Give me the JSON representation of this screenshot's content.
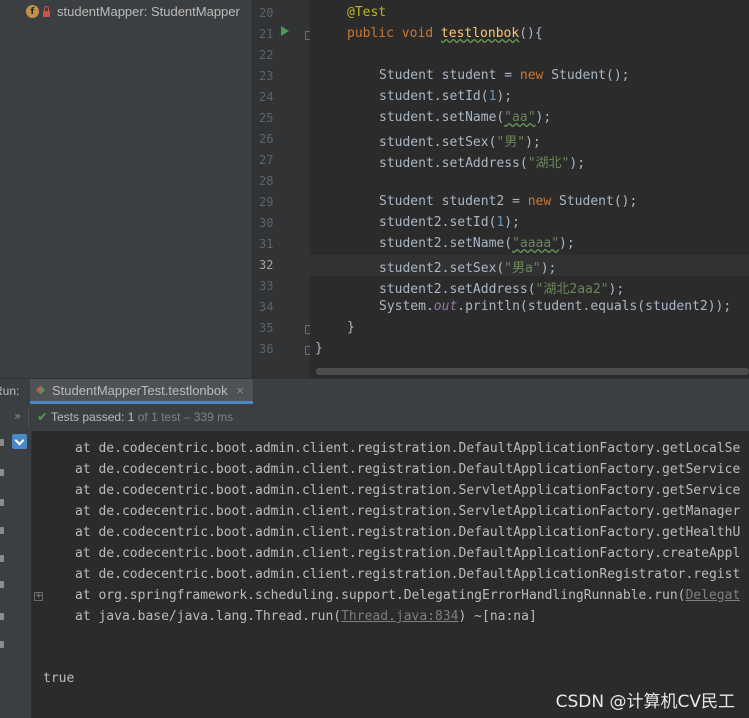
{
  "structure": {
    "item_label": "studentMapper: StudentMapper"
  },
  "gutter": {
    "line_numbers": [
      "20",
      "21",
      "22",
      "23",
      "24",
      "25",
      "26",
      "27",
      "28",
      "29",
      "30",
      "31",
      "32",
      "33",
      "34",
      "35",
      "36"
    ]
  },
  "editor": {
    "annotation": "@Test",
    "method_keywords": "public void ",
    "method_name": "testlonbok",
    "method_tail": "(){",
    "l23_type": "Student student = ",
    "l23_new": "new",
    "l23_tail": " Student();",
    "l24_call": "student.setId(",
    "l24_arg": "1",
    "l24_end": ");",
    "l25_call": "student.setName(",
    "l25_arg": "\"aa\"",
    "l25_end": ");",
    "l26_call": "student.setSex(",
    "l26_arg": "\"男\"",
    "l26_end": ");",
    "l27_call": "student.setAddress(",
    "l27_arg": "\"湖北\"",
    "l27_end": ");",
    "l29_type": "Student student2 = ",
    "l29_new": "new",
    "l29_tail": " Student();",
    "l30_call": "student2.setId(",
    "l30_arg": "1",
    "l30_end": ");",
    "l31_call": "student2.setName(",
    "l31_arg": "\"aaaa\"",
    "l31_end": ");",
    "l32_call": "student2.setSex(",
    "l32_arg": "\"男a\"",
    "l32_end": ");",
    "l33_call": "student2.setAddress(",
    "l33_arg": "\"湖北2aa2\"",
    "l33_end": ");",
    "l34_sys": "System.",
    "l34_out": "out",
    "l34_tail": ".println(student.equals(student2));",
    "l35": "}",
    "l36": "}"
  },
  "run": {
    "label": "Run:",
    "tab_label": "StudentMapperTest.testlonbok",
    "close_glyph": "×",
    "chevron": "»",
    "status_main": "Tests passed: 1",
    "status_sub": " of 1 test – 339 ms"
  },
  "console": {
    "lines": [
      "at de.codecentric.boot.admin.client.registration.DefaultApplicationFactory.getLocalSe",
      "at de.codecentric.boot.admin.client.registration.DefaultApplicationFactory.getService",
      "at de.codecentric.boot.admin.client.registration.ServletApplicationFactory.getService",
      "at de.codecentric.boot.admin.client.registration.ServletApplicationFactory.getManager",
      "at de.codecentric.boot.admin.client.registration.DefaultApplicationFactory.getHealthU",
      "at de.codecentric.boot.admin.client.registration.DefaultApplicationFactory.createAppl",
      "at de.codecentric.boot.admin.client.registration.DefaultApplicationRegistrator.regist"
    ],
    "line8_pre": "at org.springframework.scheduling.support.DelegatingErrorHandlingRunnable.run(",
    "line8_link": "Delegat",
    "line9_pre": "at java.base/java.lang.Thread.run(",
    "line9_link": "Thread.java:834",
    "line9_post": ") ~[na:na]",
    "output": "true"
  },
  "watermark": "CSDN @计算机CV民工"
}
